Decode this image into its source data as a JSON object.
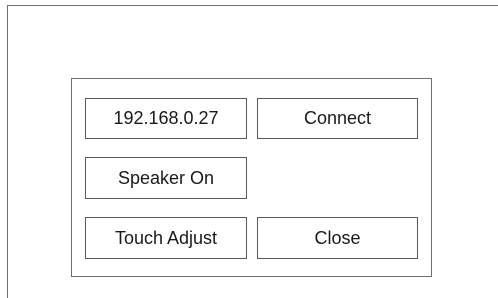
{
  "connection": {
    "ip_address": "192.168.0.27",
    "connect_label": "Connect"
  },
  "controls": {
    "speaker_label": "Speaker On",
    "touch_adjust_label": "Touch Adjust",
    "close_label": "Close"
  },
  "colors": {
    "border": "#6f6f6f",
    "text": "#1a1a1a",
    "background": "#ffffff"
  }
}
